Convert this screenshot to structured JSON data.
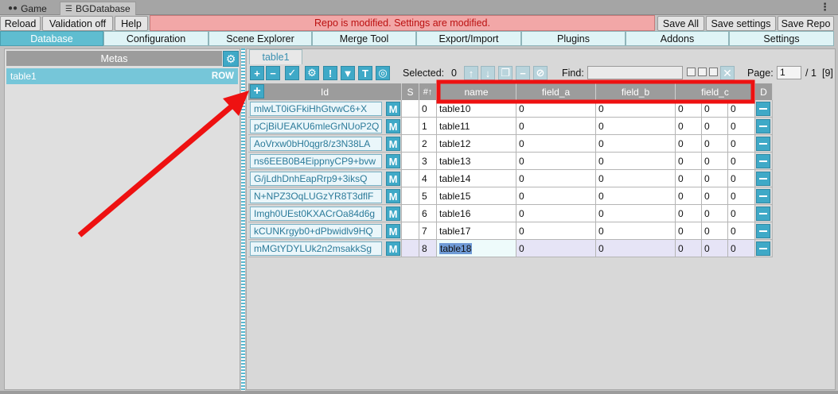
{
  "window_tabs": [
    {
      "label": "Game",
      "icon": "gamepad-icon"
    },
    {
      "label": "BGDatabase",
      "icon": "list-icon"
    }
  ],
  "toolbar": {
    "reload": "Reload",
    "validation": "Validation off",
    "help": "Help",
    "status": "Repo is modified. Settings are modified.",
    "save_all": "Save All",
    "save_settings": "Save settings",
    "save_repo": "Save Repo"
  },
  "section_tabs": [
    "Database",
    "Configuration",
    "Scene Explorer",
    "Merge Tool",
    "Export/Import",
    "Plugins",
    "Addons",
    "Settings"
  ],
  "metas": {
    "header": "Metas",
    "items": [
      {
        "name": "table1",
        "tag": "ROW"
      }
    ]
  },
  "meta_tab": "table1",
  "grid_toolbar": {
    "selected_label": "Selected:",
    "selected_value": "0",
    "find_label": "Find:",
    "page_label": "Page:",
    "page_value": "1",
    "page_total": "/ 1",
    "count": "[9]"
  },
  "columns": {
    "id": "Id",
    "s": "S",
    "index": "#↑",
    "name": "name",
    "field_a": "field_a",
    "field_b": "field_b",
    "field_c": "field_c",
    "d": "D"
  },
  "rows": [
    {
      "id": "mlwLT0iGFkiHhGtvwC6+X",
      "m": "M",
      "idx": "0",
      "name": "table10",
      "a": "0",
      "b": "0",
      "c1": "0",
      "c2": "0",
      "c3": "0"
    },
    {
      "id": "pCjBiUEAKU6mleGrNUoP2Q",
      "m": "M",
      "idx": "1",
      "name": "table11",
      "a": "0",
      "b": "0",
      "c1": "0",
      "c2": "0",
      "c3": "0"
    },
    {
      "id": "AoVrxw0bH0qgr8/z3N38LA",
      "m": "M",
      "idx": "2",
      "name": "table12",
      "a": "0",
      "b": "0",
      "c1": "0",
      "c2": "0",
      "c3": "0"
    },
    {
      "id": "ns6EEB0B4EippnyCP9+bvw",
      "m": "M",
      "idx": "3",
      "name": "table13",
      "a": "0",
      "b": "0",
      "c1": "0",
      "c2": "0",
      "c3": "0"
    },
    {
      "id": "G/jLdhDnhEapRrp9+3iksQ",
      "m": "M",
      "idx": "4",
      "name": "table14",
      "a": "0",
      "b": "0",
      "c1": "0",
      "c2": "0",
      "c3": "0"
    },
    {
      "id": "N+NPZ3OqLUGzYR8T3dflF",
      "m": "M",
      "idx": "5",
      "name": "table15",
      "a": "0",
      "b": "0",
      "c1": "0",
      "c2": "0",
      "c3": "0"
    },
    {
      "id": "Imgh0UEst0KXACrOa84d6g",
      "m": "M",
      "idx": "6",
      "name": "table16",
      "a": "0",
      "b": "0",
      "c1": "0",
      "c2": "0",
      "c3": "0"
    },
    {
      "id": "kCUNKrgyb0+dPbwidlv9HQ",
      "m": "M",
      "idx": "7",
      "name": "table17",
      "a": "0",
      "b": "0",
      "c1": "0",
      "c2": "0",
      "c3": "0"
    },
    {
      "id": "mMGtYDYLUk2n2msakkSg",
      "m": "M",
      "idx": "8",
      "name": "table18",
      "a": "0",
      "b": "0",
      "c1": "0",
      "c2": "0",
      "c3": "0"
    }
  ],
  "colors": {
    "accent": "#3fa9c7",
    "status_bg": "#f2a7a7",
    "status_text": "#bb1111",
    "annotation": "#ee1111"
  }
}
